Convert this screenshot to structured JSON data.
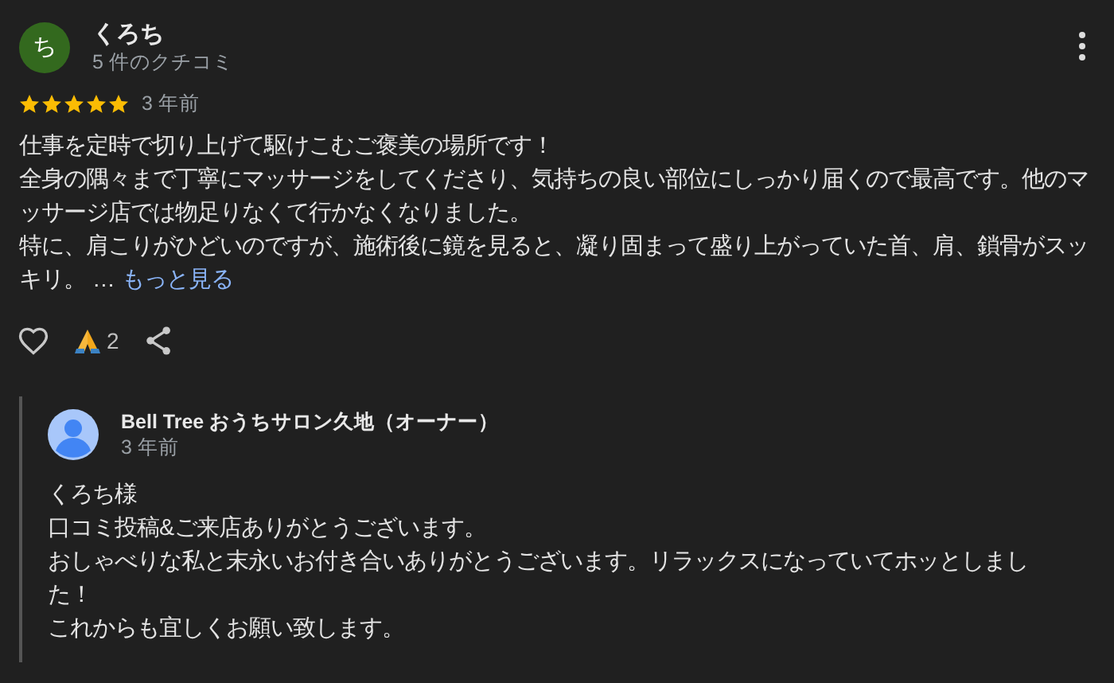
{
  "review": {
    "avatar_letter": "ち",
    "author": "くろち",
    "review_count": "5 件のクチコミ",
    "stars": 5,
    "time": "3 年前",
    "body": [
      "仕事を定時で切り上げて駆けこむご褒美の場所です！",
      "全身の隅々まで丁寧にマッサージをしてくださり、気持ちの良い部位にしっかり届くので最高です。他のマッサージ店では物足りなくて行かなくなりました。",
      "特に、肩こりがひどいのですが、施術後に鏡を見ると、凝り固まって盛り上がっていた首、肩、鎖骨がスッキリ。 …"
    ],
    "more_link": "もっと見る",
    "reaction_count": "2"
  },
  "owner_reply": {
    "author": "Bell Tree おうちサロン久地（オーナー）",
    "time": "3 年前",
    "body": [
      "くろち様",
      "口コミ投稿&ご来店ありがとうございます。",
      "おしゃべりな私と末永いお付き合いありがとうございます。リラックスになっていてホッとしました！",
      "これからも宜しくお願い致します。"
    ]
  }
}
